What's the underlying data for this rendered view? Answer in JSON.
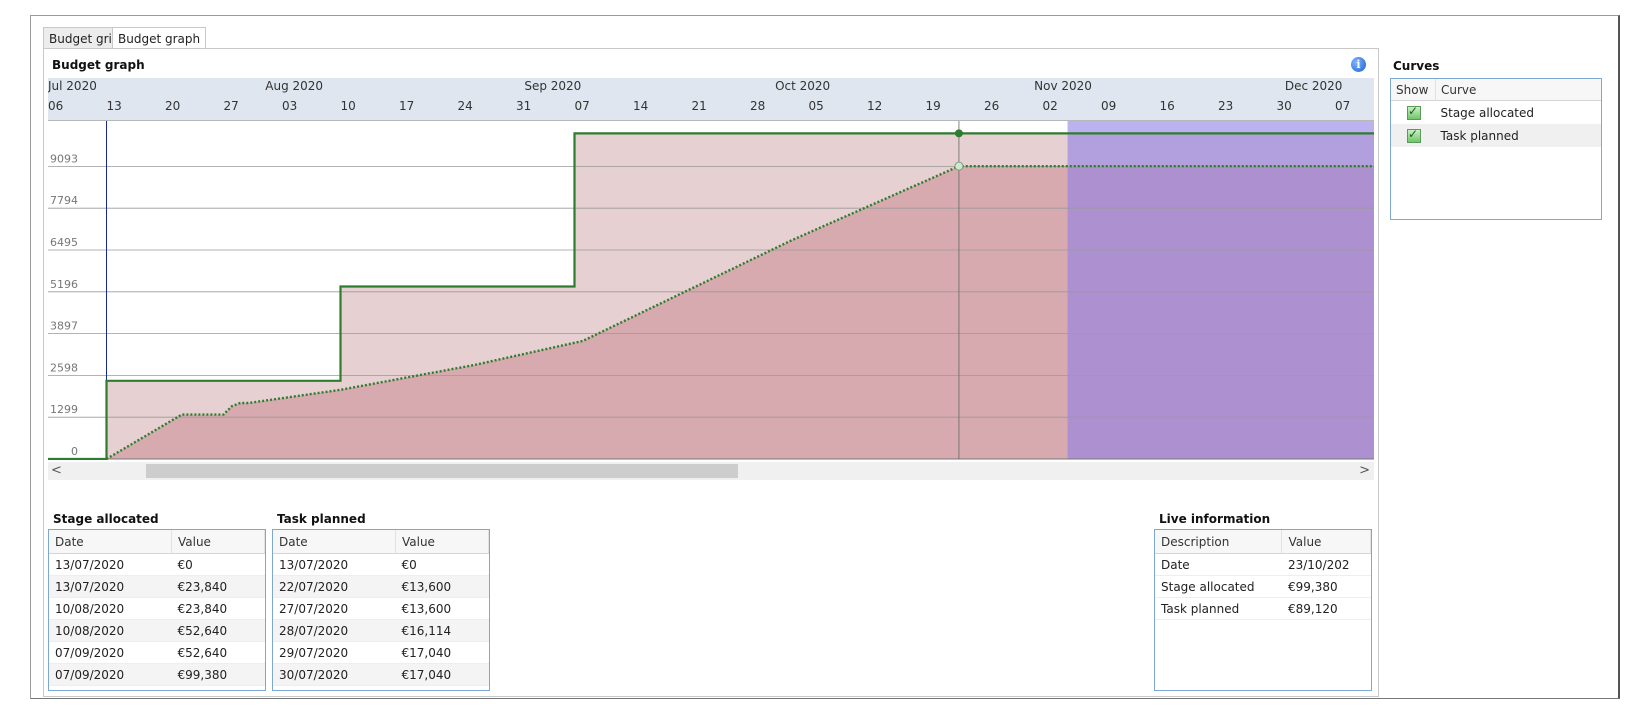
{
  "tabs": [
    {
      "label": "Budget grid",
      "active": false
    },
    {
      "label": "Budget graph",
      "active": true
    }
  ],
  "graph": {
    "title": "Budget graph",
    "info_icon": "info-icon",
    "months": [
      "Jul 2020",
      "Aug 2020",
      "Sep 2020",
      "Oct 2020",
      "Nov 2020",
      "Dec 2020"
    ],
    "weeks": [
      "06",
      "13",
      "20",
      "27",
      "03",
      "10",
      "17",
      "24",
      "31",
      "07",
      "14",
      "21",
      "28",
      "05",
      "12",
      "19",
      "26",
      "02",
      "09",
      "16",
      "23",
      "30",
      "07"
    ],
    "y_ticks": [
      "0",
      "1299",
      "2598",
      "3897",
      "5196",
      "6495",
      "7794",
      "9093"
    ],
    "scroll_left": "<",
    "scroll_right": ">"
  },
  "chart_data": {
    "type": "area",
    "x_axis": "date",
    "y_ticks": [
      0,
      1299,
      2598,
      3897,
      5196,
      6495,
      7794,
      9093
    ],
    "series": [
      {
        "name": "Stage allocated",
        "style": "solid-step",
        "color": "#2e7d2e",
        "points": [
          [
            "2020-07-06",
            0
          ],
          [
            "2020-07-13",
            0
          ],
          [
            "2020-07-13",
            2430
          ],
          [
            "2020-08-10",
            2430
          ],
          [
            "2020-08-10",
            5360
          ],
          [
            "2020-09-07",
            5360
          ],
          [
            "2020-09-07",
            10120
          ],
          [
            "2020-12-12",
            10120
          ]
        ]
      },
      {
        "name": "Task planned",
        "style": "dotted",
        "color": "#2e7d2e",
        "points": [
          [
            "2020-07-13",
            0
          ],
          [
            "2020-07-22",
            1380
          ],
          [
            "2020-07-27",
            1380
          ],
          [
            "2020-07-28",
            1640
          ],
          [
            "2020-07-29",
            1740
          ],
          [
            "2020-07-30",
            1740
          ],
          [
            "2020-08-10",
            2150
          ],
          [
            "2020-08-26",
            2920
          ],
          [
            "2020-09-08",
            3670
          ],
          [
            "2020-10-03",
            6800
          ],
          [
            "2020-10-23",
            9100
          ],
          [
            "2020-12-12",
            9100
          ]
        ]
      }
    ],
    "cursor_date": "2020-10-23",
    "highlight_start": "2020-11-05",
    "colors": {
      "allocated_fill": "#e6d0d2",
      "planned_fill": "#d6aaae",
      "highlight": "#8f7fe6",
      "line": "#2e7d2e"
    }
  },
  "stage_allocated": {
    "title": "Stage allocated",
    "headers": [
      "Date",
      "Value"
    ],
    "rows": [
      [
        "13/07/2020",
        "€0"
      ],
      [
        "13/07/2020",
        "€23,840"
      ],
      [
        "10/08/2020",
        "€23,840"
      ],
      [
        "10/08/2020",
        "€52,640"
      ],
      [
        "07/09/2020",
        "€52,640"
      ],
      [
        "07/09/2020",
        "€99,380"
      ]
    ]
  },
  "task_planned": {
    "title": "Task planned",
    "headers": [
      "Date",
      "Value"
    ],
    "rows": [
      [
        "13/07/2020",
        "€0"
      ],
      [
        "22/07/2020",
        "€13,600"
      ],
      [
        "27/07/2020",
        "€13,600"
      ],
      [
        "28/07/2020",
        "€16,114"
      ],
      [
        "29/07/2020",
        "€17,040"
      ],
      [
        "30/07/2020",
        "€17,040"
      ]
    ]
  },
  "live_information": {
    "title": "Live information",
    "headers": [
      "Description",
      "Value"
    ],
    "rows": [
      [
        "Date",
        "23/10/202"
      ],
      [
        "Stage allocated",
        "€99,380"
      ],
      [
        "Task planned",
        "€89,120"
      ]
    ]
  },
  "curves": {
    "title": "Curves",
    "headers": [
      "Show",
      "Curve"
    ],
    "items": [
      {
        "label": "Stage allocated",
        "checked": true
      },
      {
        "label": "Task planned",
        "checked": true
      }
    ]
  }
}
